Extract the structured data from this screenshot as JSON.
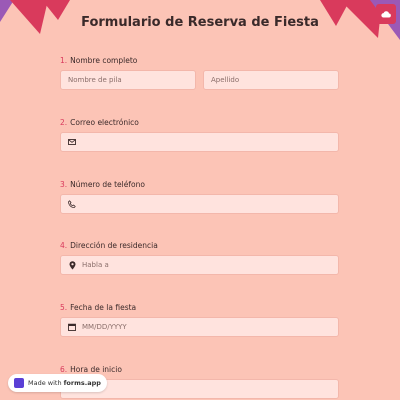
{
  "form": {
    "title": "Formulario de Reserva de Fiesta",
    "questions": [
      {
        "num": "1.",
        "label": "Nombre completo",
        "first_placeholder": "Nombre de pila",
        "last_placeholder": "Apellido"
      },
      {
        "num": "2.",
        "label": "Correo electrónico",
        "icon": "envelope-icon"
      },
      {
        "num": "3.",
        "label": "Número de teléfono",
        "icon": "phone-icon"
      },
      {
        "num": "4.",
        "label": "Dirección de residencia",
        "placeholder": "Habla a",
        "icon": "location-pin-icon"
      },
      {
        "num": "5.",
        "label": "Fecha de la fiesta",
        "placeholder": "MM/DD/YYYY",
        "icon": "calendar-icon"
      },
      {
        "num": "6.",
        "label": "Hora de inicio"
      }
    ]
  },
  "badge": {
    "prefix": "Made with",
    "brand": "forms.app"
  },
  "colors": {
    "background": "#fcc4b6",
    "accent": "#d93a5c",
    "field_bg": "#ffe3de"
  }
}
